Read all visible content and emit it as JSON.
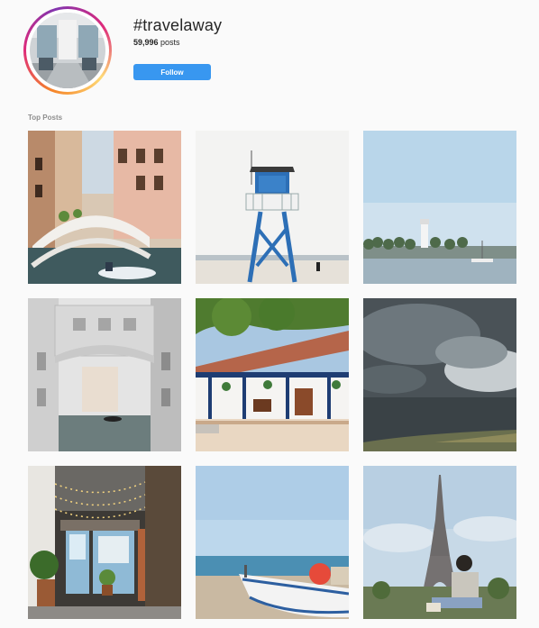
{
  "profile": {
    "hashtag": "#travelaway",
    "post_count_number": "59,996",
    "post_count_suffix": " posts",
    "follow_label": "Follow"
  },
  "section": {
    "top_posts_label": "Top Posts"
  },
  "grid": {
    "tiles": [
      {
        "subject": "venice-canal-bridge"
      },
      {
        "subject": "lifeguard-tower"
      },
      {
        "subject": "harbor-lighthouse"
      },
      {
        "subject": "bridge-of-sighs"
      },
      {
        "subject": "hacienda-porch"
      },
      {
        "subject": "storm-clouds"
      },
      {
        "subject": "courtyard-string-lights"
      },
      {
        "subject": "beached-rowboat"
      },
      {
        "subject": "eiffel-tower-portrait"
      }
    ]
  },
  "colors": {
    "accent": "#3897f0",
    "background": "#fafafa",
    "text": "#262626",
    "muted": "#8e8e8e"
  }
}
